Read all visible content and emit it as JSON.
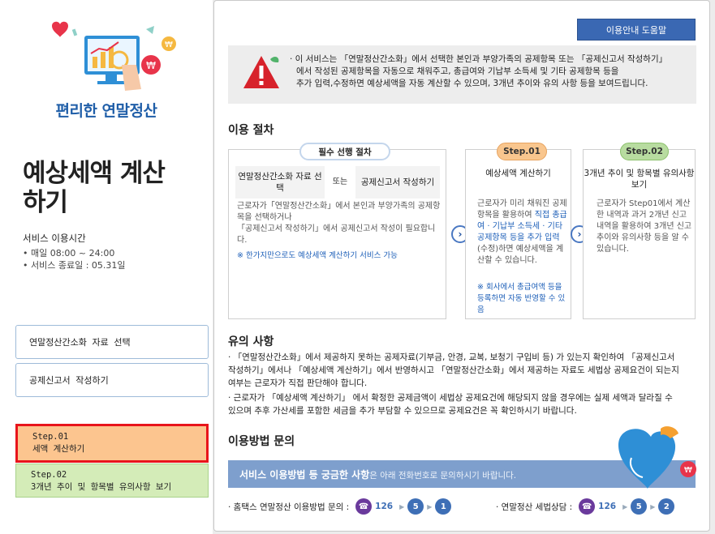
{
  "sidebar": {
    "brand": "편리한 연말정산",
    "title": "예상세액 계산하기",
    "service_hours_label": "서비스 이용시간",
    "service_hours_1": "• 매일 08:00  ~ 24:00",
    "service_hours_2": "• 서비스 종료일 : 05.31일",
    "nav": {
      "select_data": "연말정산간소화 자료 선택",
      "write_report": "공제신고서 작성하기",
      "step1_num": "Step.01",
      "step1_label": "세액 계산하기",
      "step2_num": "Step.02",
      "step2_label": "3개년 추이 및 항목별 유의사항 보기"
    }
  },
  "main": {
    "help_button": "이용안내 도움말",
    "notice_1": "· 이 서비스는 「연말정산간소화」에서 선택한 본인과 부양가족의 공제항목 또는 「공제신고서 작성하기」",
    "notice_2": "에서 작성된 공제항목을 자동으로 채워주고, 총급여와 기납부 소득세 및 기타 공제항목 등을",
    "notice_3": "추가 입력,수정하면 예상세액을 자동 계산할 수 있으며, 3개년 추이와 유의 사항 등을 보여드립니다.",
    "procedure": {
      "title": "이용 절차",
      "pre": {
        "pill": "필수 선행 절차",
        "head_left": "연말정산간소화 자료 선택",
        "head_or": "또는",
        "head_right": "공제신고서 작성하기",
        "text_1": "근로자가「연말정산간소화」에서 본인과 부양가족의 공제항목을 선택하거나",
        "text_2": "「공제신고서 작성하기」에서 공제신고서 작성이 필요합니다.",
        "note": "※ 한가지만으로도 예상세액 계산하기 서비스 가능"
      },
      "step1": {
        "pill": "Step.01",
        "head": "예상세액 계산하기",
        "text_a": "근로자가 미리 채워진 공제항목을 활용하여",
        "text_hl": "직접 총급여 · 기납부 소득세 · 기타 공제항목 등을 추가 입력",
        "text_b": "(수정)하면 예상세액을 계산할 수 있습니다.",
        "note": "※ 회사에서 총급여액 등을 등록하면 자동 반영할 수 있음"
      },
      "step2": {
        "pill": "Step.02",
        "head": "3개년 추이 및 항목별 유의사항 보기",
        "text": "근로자가 Step01에서 계산한 내역과 과거 2개년 신고내역을 활용하여 3개년 신고 추이와 유의사항 등을 알 수 있습니다."
      },
      "arrow": "›"
    },
    "caution": {
      "title": "유의 사항",
      "item_1": "· 「연말정산간소화」에서 제공하지 못하는 공제자료(기부금, 안경, 교복, 보청기 구입비 등) 가 있는지 확인하여 「공제신고서 작성하기」에서나 「예상세액 계산하기」에서 반영하시고 「연말정산간소화」에서 제공하는 자료도 세법상 공제요건이 되는지 여부는 근로자가 직접 판단해야 합니다.",
      "item_2": "· 근로자가 「예상세액 계산하기」 에서 확정한 공제금액이 세법상 공제요건에 해당되지 않을 경우에는 실제 세액과 달라질 수 있으며 추후 가산세를 포함한 세금을 추가 부담할 수 있으므로 공제요건은 꼭 확인하시기 바랍니다."
    },
    "contact": {
      "title": "이용방법 문의",
      "band_bold": "서비스 이용방법 등 궁금한 사항",
      "band_rest": "은 아래 전화번호로 문의하시기 바랍니다.",
      "hometax_label": "· 홈택스 연말정산 이용방법 문의 :",
      "hometax_num": "126",
      "hometax_d1": "5",
      "hometax_d2": "1",
      "tax_label": "· 연말정산 세법상담 :",
      "tax_num": "126",
      "tax_d1": "5",
      "tax_d2": "2"
    }
  },
  "colors": {
    "accent_blue": "#3a68b3",
    "brand_blue": "#1f5ea8",
    "step1_orange": "#fcc58f",
    "step2_green": "#d4ecb8",
    "highlight_red": "#e8141b"
  },
  "icons": [
    "monitor-chart-icon",
    "heart-icon",
    "won-coin-icon",
    "warning-icon",
    "chevron-right-icon",
    "phone-icon",
    "triangle-right-icon"
  ]
}
